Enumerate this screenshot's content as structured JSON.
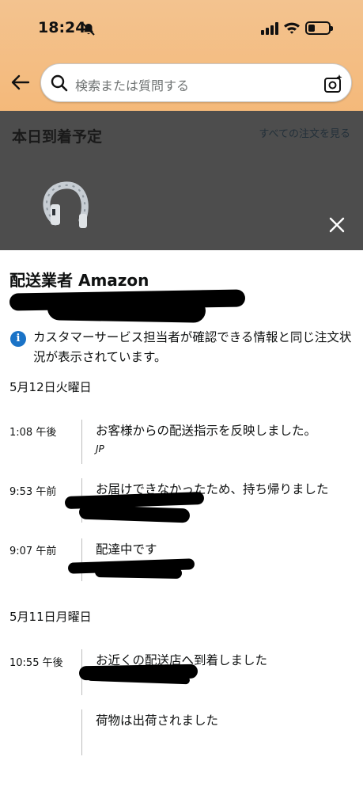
{
  "status_bar": {
    "time": "18:24"
  },
  "search": {
    "placeholder": "検索または質問する"
  },
  "background": {
    "title": "本日到着予定",
    "link": "すべての注文を見る"
  },
  "sheet": {
    "carrier": "配送業者 Amazon",
    "info_text": "カスタマーサービス担当者が確認できる情報と同じ注文状況が表示されています。",
    "groups": [
      {
        "date": "5月12日火曜日",
        "events": [
          {
            "time": "1:08 午後",
            "text": "お客様からの配送指示を反映しました。",
            "sub": "JP"
          },
          {
            "time": "9:53 午前",
            "text": "お届けできなかったため、持ち帰りました"
          },
          {
            "time": "9:07 午前",
            "text": "配達中です"
          }
        ]
      },
      {
        "date": "5月11日月曜日",
        "events": [
          {
            "time": "10:55 午後",
            "text": "お近くの配送店へ到着しました"
          },
          {
            "time": "",
            "text": "荷物は出荷されました"
          }
        ]
      }
    ]
  },
  "colors": {
    "header": "#f4b97a",
    "info_blue": "#1a73c7",
    "overlay": "#4d4d4d"
  }
}
